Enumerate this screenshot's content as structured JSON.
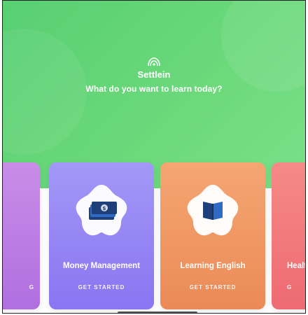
{
  "header": {
    "brand": "Settlein",
    "question": "What do you want to learn today?",
    "logo_icon": "settlein-logo-icon"
  },
  "cards": [
    {
      "title": "",
      "cta": "G",
      "icon": "partial-card-icon",
      "color": "#b06fe0"
    },
    {
      "title": "Money Management",
      "cta": "GET STARTED",
      "icon": "money-stack-icon",
      "color": "#8a75f2"
    },
    {
      "title": "Learning English",
      "cta": "GET STARTED",
      "icon": "book-icon",
      "color": "#eb8a56"
    },
    {
      "title": "Healt",
      "cta": "G",
      "icon": "health-icon",
      "color": "#ee6a72"
    }
  ],
  "colors": {
    "hero_green": "#5fd476",
    "icon_dark": "#1f3f7a",
    "icon_blue": "#2f6bc4"
  }
}
